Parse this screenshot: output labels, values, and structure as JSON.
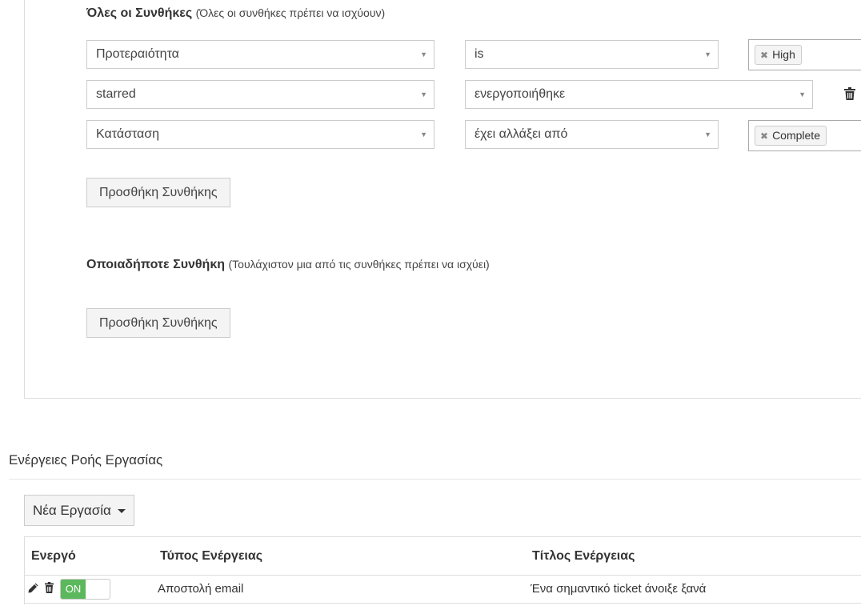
{
  "all_conditions": {
    "title": "Όλες οι Συνθήκες",
    "hint": "(Όλες οι συνθήκες πρέπει να ισχύουν)",
    "rows": [
      {
        "field": "Προτεραιότητα",
        "operator": "is",
        "value_tag": "High"
      },
      {
        "field": "starred",
        "operator": "ενεργοποιήθηκε"
      },
      {
        "field": "Κατάσταση",
        "operator": "έχει αλλάξει από",
        "value_tag": "Complete"
      }
    ],
    "add_button": "Προσθήκη Συνθήκης"
  },
  "any_conditions": {
    "title": "Οποιαδήποτε Συνθήκη",
    "hint": "(Τουλάχιστον μια από τις συνθήκες πρέπει να ισχύει)",
    "add_button": "Προσθήκη Συνθήκης"
  },
  "actions": {
    "section_title": "Ενέργειες Ροής Εργασίας",
    "new_task_button": "Νέα Εργασία",
    "columns": [
      "Ενεργό",
      "Τύπος Ενέργειας",
      "Τίτλος Ενέργειας"
    ],
    "rows": [
      {
        "toggle": "ON",
        "type": "Αποστολή email",
        "title": "Ένα σημαντικό ticket άνοιξε ξανά"
      }
    ]
  },
  "icons": {
    "caret": "caret-down-icon",
    "remove": "remove-tag-icon",
    "trash": "trash-icon",
    "edit": "pencil-icon"
  },
  "colors": {
    "toggle_on": "#5cb85c",
    "border": "#cccccc"
  }
}
